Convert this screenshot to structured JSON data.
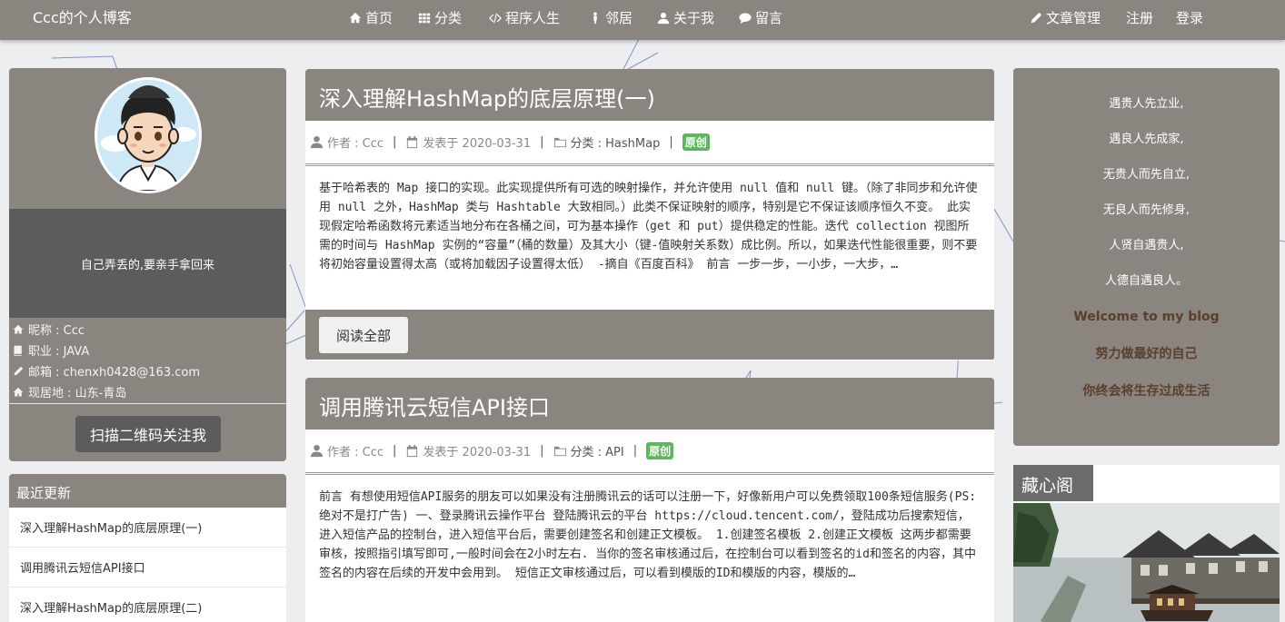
{
  "navbar": {
    "brand": "Ccc的个人博客",
    "items": [
      {
        "label": "首页",
        "icon": "home-icon"
      },
      {
        "label": "分类",
        "icon": "grid-icon"
      },
      {
        "label": "程序人生",
        "icon": "code-icon"
      },
      {
        "label": "邻居",
        "icon": "person-standing-icon"
      },
      {
        "label": "关于我",
        "icon": "user-icon"
      },
      {
        "label": "留言",
        "icon": "comment-icon"
      }
    ],
    "right": [
      {
        "label": "文章管理",
        "icon": "pencil-icon"
      },
      {
        "label": "注册"
      },
      {
        "label": "登录"
      }
    ]
  },
  "profile": {
    "motto": "自己弄丢的,要亲手拿回来",
    "info": [
      {
        "label": "昵称 : Ccc",
        "icon": "home-icon"
      },
      {
        "label": "职业 : JAVA",
        "icon": "book-icon"
      },
      {
        "label": "邮箱 : chenxh0428@163.com",
        "icon": "pencil-icon"
      },
      {
        "label": "现居地 : 山东-青岛",
        "icon": "home-icon"
      }
    ],
    "qr_button": "扫描二维码关注我"
  },
  "recent": {
    "title": "最近更新",
    "items": [
      "深入理解HashMap的底层原理(一)",
      "调用腾讯云短信API接口",
      "深入理解HashMap的底层原理(二)"
    ]
  },
  "articles": [
    {
      "title": "深入理解HashMap的底层原理(一)",
      "author": "作者 : Ccc",
      "date": "发表于 2020-03-31",
      "category": "分类 : HashMap",
      "badge": "原创",
      "summary": "基于哈希表的 Map 接口的实现。此实现提供所有可选的映射操作，并允许使用 null 值和 null 键。（除了非同步和允许使用 null 之外，HashMap 类与 Hashtable 大致相同。）此类不保证映射的顺序，特别是它不保证该顺序恒久不变。 此实现假定哈希函数将元素适当地分布在各桶之间，可为基本操作（get 和 put）提供稳定的性能。迭代 collection 视图所需的时间与 HashMap 实例的“容量”（桶的数量）及其大小（键-值映射关系数）成比例。所以，如果迭代性能很重要，则不要将初始容量设置得太高（或将加载因子设置得太低） -摘自《百度百科》 前言 一步一步，一小步，一大步，…",
      "read_more": "阅读全部"
    },
    {
      "title": "调用腾讯云短信API接口",
      "author": "作者 : Ccc",
      "date": "发表于 2020-03-31",
      "category": "分类 : API",
      "badge": "原创",
      "summary": "前言 有想使用短信API服务的朋友可以如果没有注册腾讯云的话可以注册一下，好像新用户可以免费领取100条短信服务(PS:绝对不是打广告) 一、登录腾讯云操作平台 登陆腾讯云的平台 https://cloud.tencent.com/，登陆成功后搜索短信，进入短信产品的控制台，进入短信平台后，需要创建签名和创建正文模板。 1.创建签名模板 2.创建正文模板 这两步都需要审核，按照指引填写即可,一般时间会在2小时左右. 当你的签名审核通过后，在控制台可以看到签名的id和签名的内容，其中签名的内容在后续的开发中会用到。 短信正文审核通过后，可以看到模版的ID和模版的内容，模版的…"
    }
  ],
  "quotes": {
    "lines": [
      "遇贵人先立业,",
      "遇良人先成家,",
      "无贵人而先自立,",
      "无良人而先修身,",
      "人贤自遇贵人,",
      "人德自遇良人。"
    ],
    "bold": [
      "Welcome to my blog",
      "努力做最好的自己",
      "你终会将生存过成生活"
    ]
  },
  "collection": {
    "title": "藏心阁"
  },
  "colors": {
    "nav_bg": "#8a867f",
    "dark_band": "#5c5c5c",
    "badge_green": "#5cb85c",
    "quote_accent": "#5a3e2e"
  }
}
